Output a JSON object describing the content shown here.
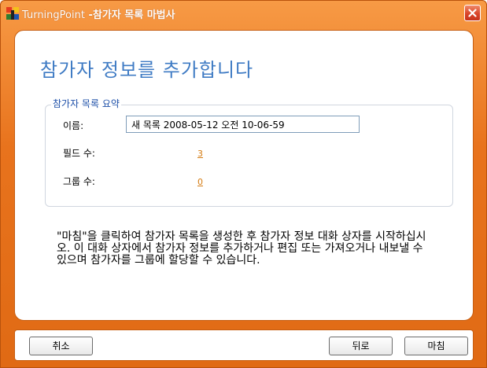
{
  "window": {
    "title_app": "TurningPoint",
    "title_sep": " -",
    "title_wizard": "참가자 목록 마법사"
  },
  "heading": "참가자 정보를 추가합니다",
  "summary": {
    "legend": "참가자 목록 요약",
    "name_label": "이름:",
    "name_value": "새 목록 2008-05-12 오전 10-06-59",
    "fields_label": "필드 수:",
    "fields_count": "3",
    "groups_label": "그룹 수:",
    "groups_count": "0"
  },
  "instructions": "\"마침\"을 클릭하여 참가자 목록을 생성한 후 참가자 정보 대화 상자를 시작하십시오. 이 대화 상자에서 참가자 정보를 추가하거나 편집 또는 가져오거나 내보낼 수 있으며 참가자를 그룹에 할당할 수 있습니다.",
  "buttons": {
    "cancel": "취소",
    "back": "뒤로",
    "finish": "마침"
  },
  "icons": {
    "app": "turningpoint-app-icon",
    "close": "close-icon"
  },
  "colors": {
    "frame": "#e8731d",
    "heading": "#3f7bc4",
    "legend": "#1d4fa8",
    "link": "#d47a10"
  }
}
